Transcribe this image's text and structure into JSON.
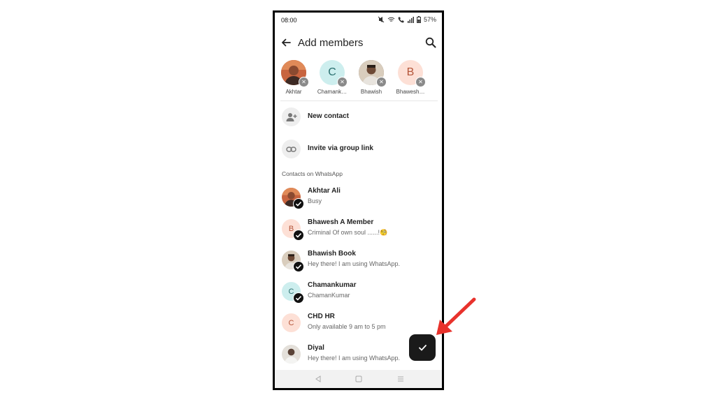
{
  "status": {
    "time": "08:00",
    "battery": "57%"
  },
  "appbar": {
    "title": "Add members"
  },
  "selected": [
    {
      "name": "Akhtar",
      "initial": "",
      "bg": "#b4563c"
    },
    {
      "name": "Chamank…",
      "initial": "C",
      "bg": "#cdeeee",
      "fg": "#2a6f6f"
    },
    {
      "name": "Bhawish",
      "initial": "",
      "bg": "#7a6658"
    },
    {
      "name": "Bhawesh…",
      "initial": "B",
      "bg": "#fde0d6",
      "fg": "#b45539"
    }
  ],
  "actions": [
    {
      "label": "New contact",
      "icon": "add-person-icon"
    },
    {
      "label": "Invite via group link",
      "icon": "link-icon"
    }
  ],
  "section_label": "Contacts on WhatsApp",
  "contacts": [
    {
      "name": "Akhtar Ali",
      "status": "Busy",
      "initial": "",
      "checked": true
    },
    {
      "name": "Bhawesh A Member",
      "status": "Criminal Of own soul ......!🧐",
      "initial": "B",
      "checked": true
    },
    {
      "name": "Bhawish Book",
      "status": "Hey there! I am using WhatsApp.",
      "initial": "",
      "checked": true
    },
    {
      "name": "Chamankumar",
      "status": "ChamanKumar",
      "initial": "C",
      "checked": true
    },
    {
      "name": "CHD HR",
      "status": "Only available 9 am to 5 pm",
      "initial": "C",
      "checked": false
    },
    {
      "name": "Diyal",
      "status": "Hey there! I am using WhatsApp.",
      "initial": "",
      "checked": false
    }
  ],
  "colors": {
    "fab": "#1a1a1a",
    "arrow": "#e8322c",
    "check": "#111111"
  }
}
